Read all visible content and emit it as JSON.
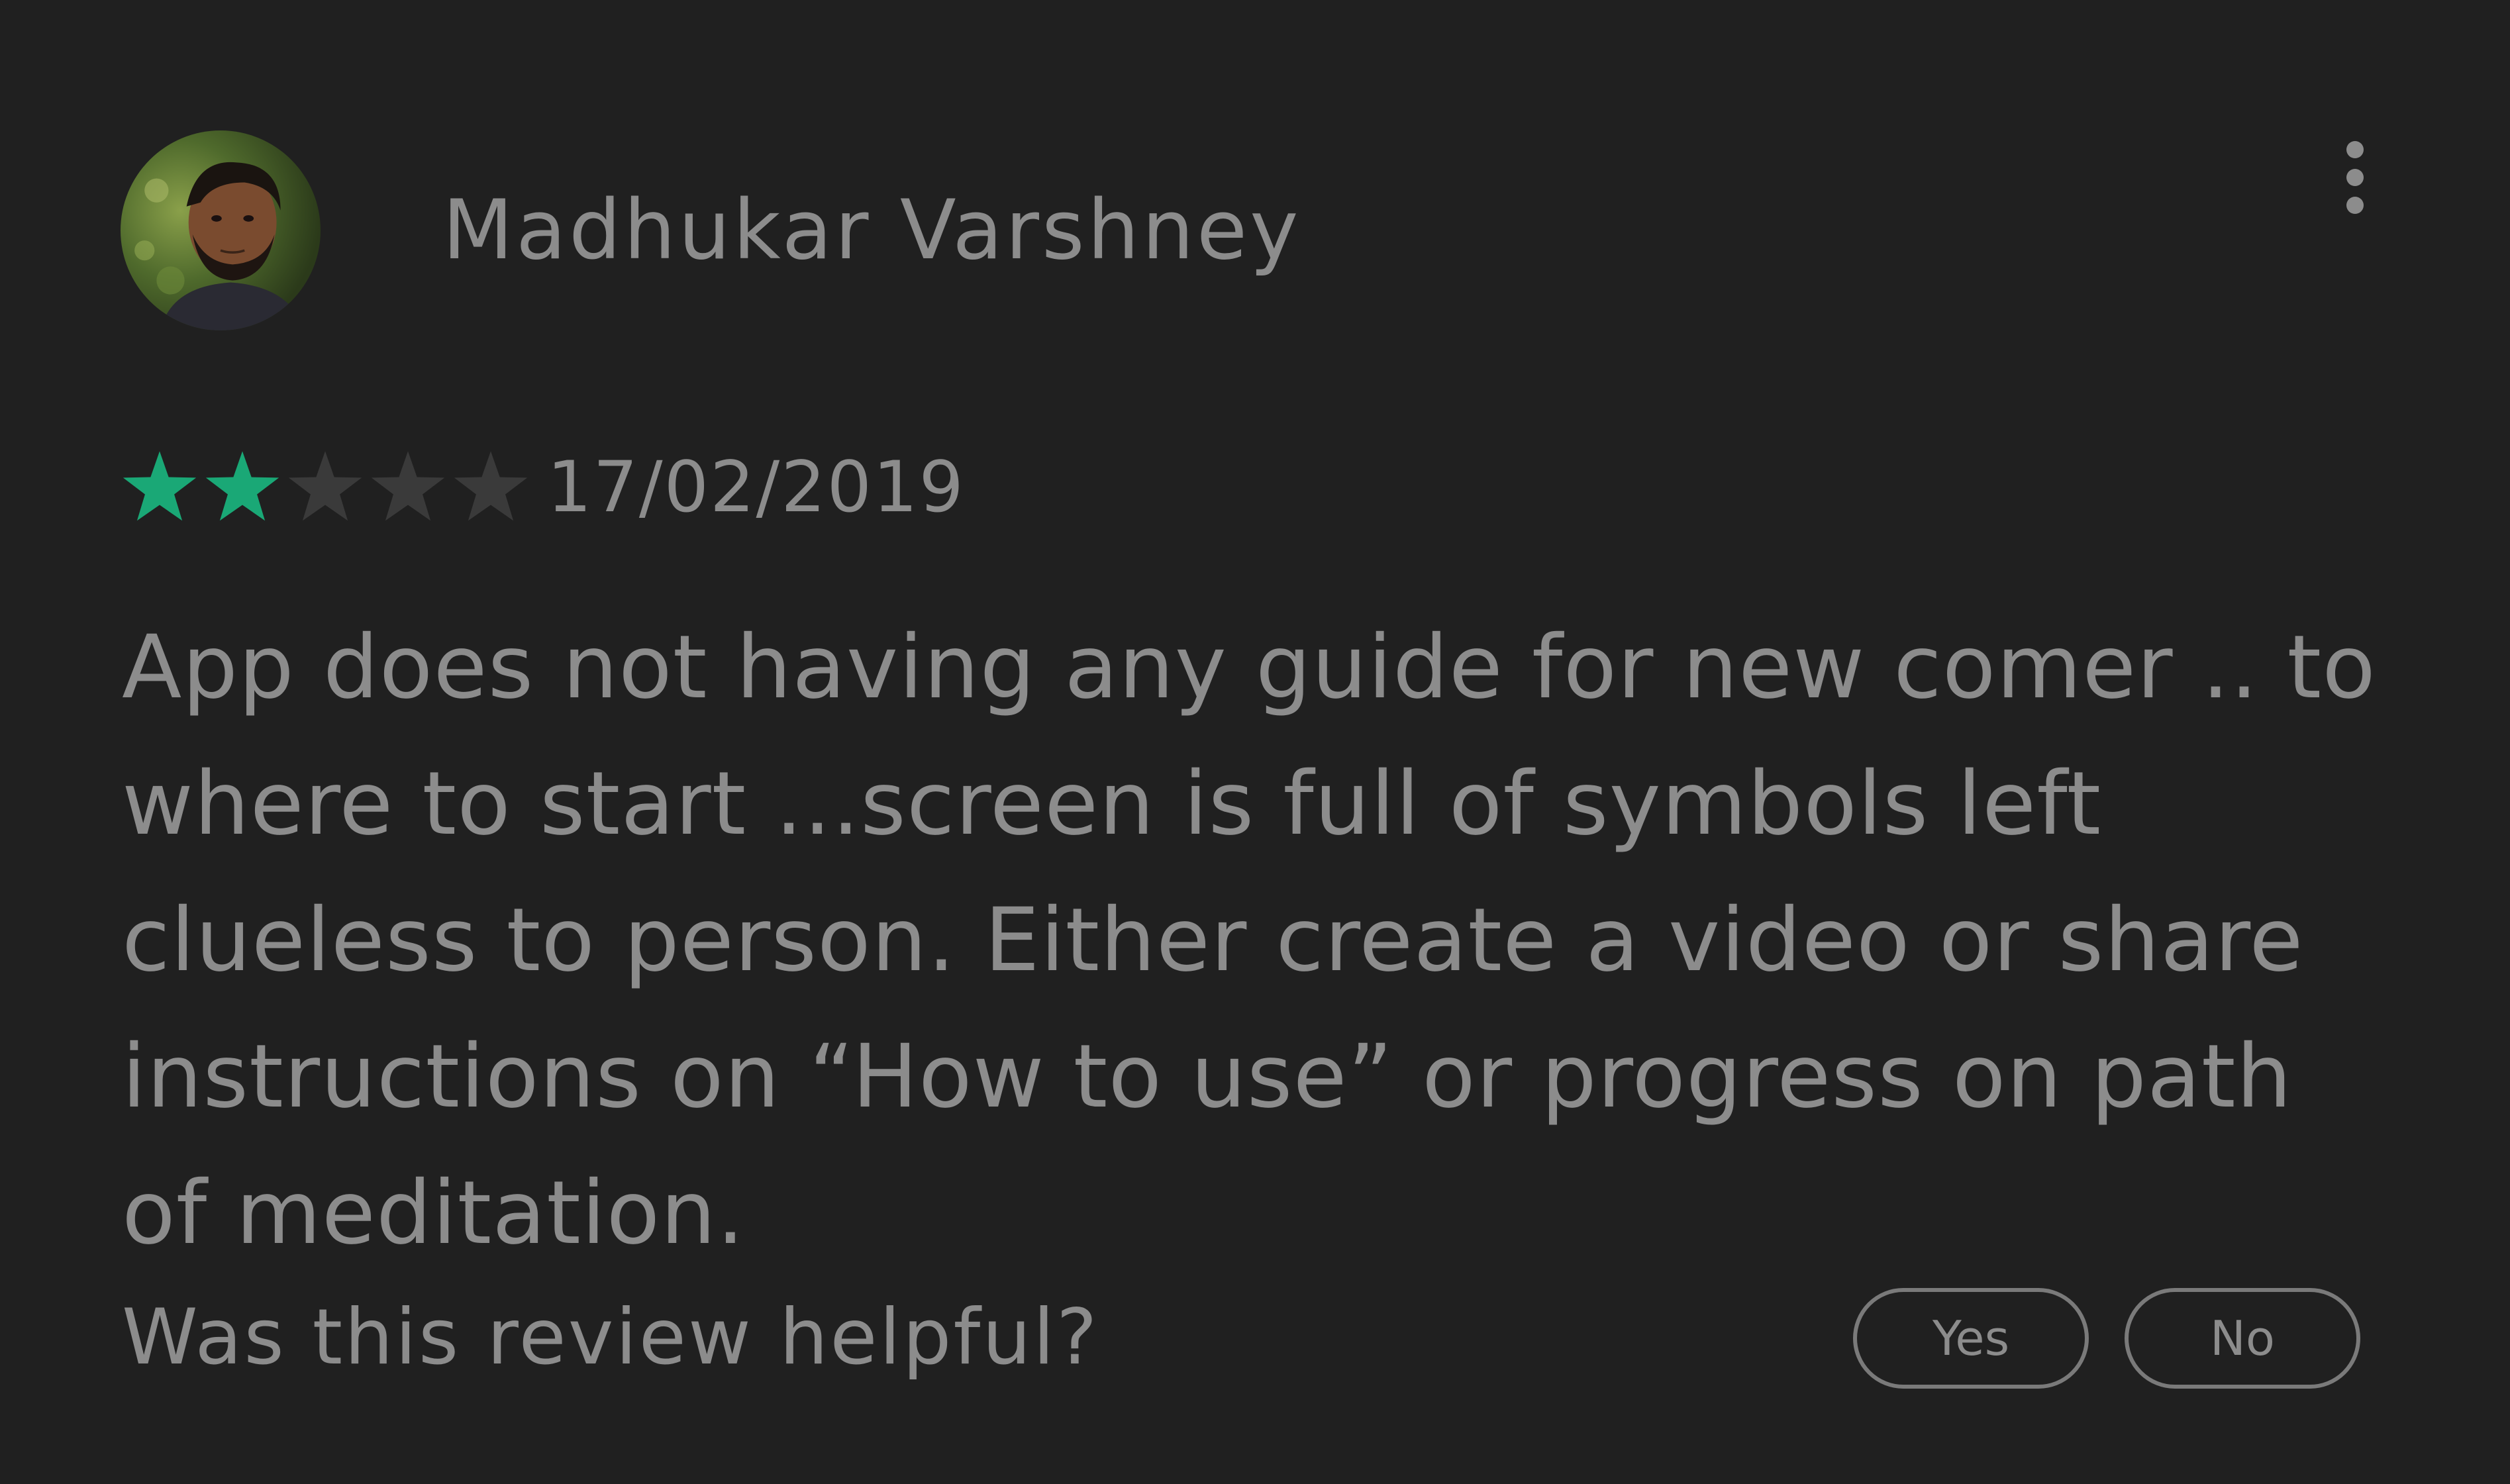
{
  "review": {
    "author_name": "Madhukar Varshney",
    "rating": {
      "filled": 2,
      "max": 5,
      "filled_color": "#1aa876",
      "empty_color": "#3a3a3a"
    },
    "date": "17/02/2019",
    "body": "App does not having any guide for new comer .. to where to start ...screen is full of symbols left clueless to person. Either create a video or share instructions on “How to use” or progress on path of meditation."
  },
  "feedback": {
    "question": "Was this review helpful?",
    "yes_label": "Yes",
    "no_label": "No"
  },
  "icons": {
    "more": "more-vertical-icon",
    "star": "star-icon"
  },
  "colors": {
    "background": "#202020",
    "text": "#8c8c8c",
    "accent": "#1aa876",
    "button_border": "#7a7a7a"
  }
}
